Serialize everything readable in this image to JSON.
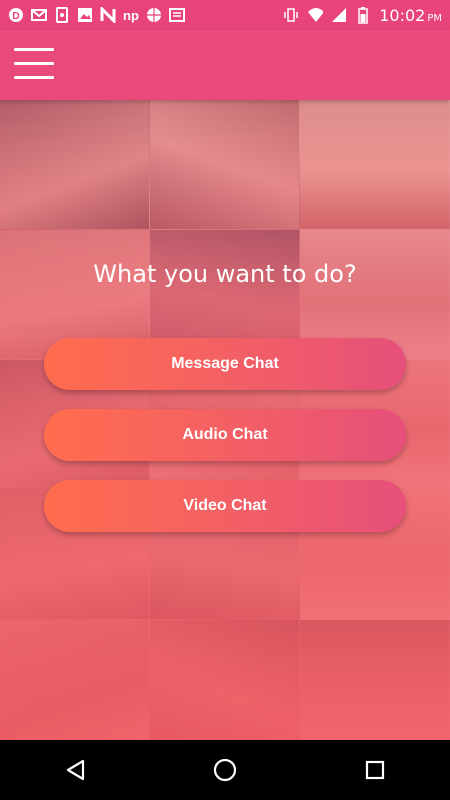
{
  "status_bar": {
    "time": "10:02",
    "ampm": "PM",
    "left_icons": [
      "circle-d-icon",
      "gmail-icon",
      "phone-clock-icon",
      "image-icon",
      "n-icon",
      "np-icon",
      "basketball-icon",
      "news-icon"
    ],
    "right_icons": [
      "vibrate-icon",
      "wifi-icon",
      "signal-icon",
      "battery-icon"
    ]
  },
  "app_bar": {
    "menu_icon": "hamburger-menu-icon"
  },
  "main": {
    "question": "What you want to do?",
    "buttons": [
      {
        "label": "Message Chat"
      },
      {
        "label": "Audio Chat"
      },
      {
        "label": "Video Chat"
      }
    ]
  },
  "colors": {
    "status_bar": "#e8447a",
    "app_bar": "#e84a7c",
    "button_start": "#ff6d4e",
    "button_end": "#e64f7a"
  },
  "nav_bar": {
    "icons": [
      "back-triangle-icon",
      "home-circle-icon",
      "recents-square-icon"
    ]
  }
}
